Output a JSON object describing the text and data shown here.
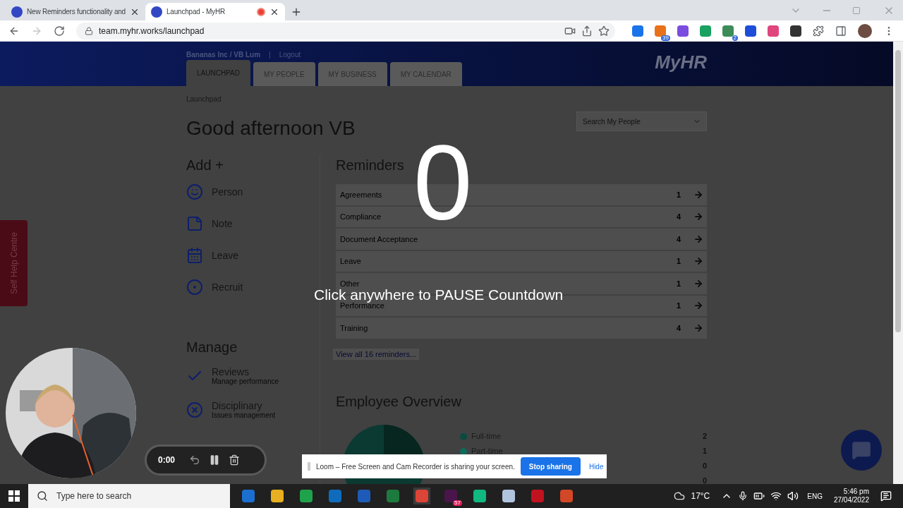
{
  "browser": {
    "tabs": [
      {
        "title": "New Reminders functionality and",
        "selected": false,
        "recording": false
      },
      {
        "title": "Launchpad - MyHR",
        "selected": true,
        "recording": true
      }
    ],
    "url": "team.myhr.works/launchpad",
    "extension_badges": [
      "39",
      "2"
    ]
  },
  "header": {
    "account": "Bananas Inc / VB Lum",
    "separator": "|",
    "logout": "Logout",
    "logo": "MyHR",
    "nav": [
      {
        "label": "LAUNCHPAD",
        "selected": true
      },
      {
        "label": "MY PEOPLE",
        "selected": false
      },
      {
        "label": "MY BUSINESS",
        "selected": false
      },
      {
        "label": "MY CALENDAR",
        "selected": false
      }
    ]
  },
  "breadcrumb": "Launchpad",
  "greeting": "Good afternoon VB",
  "search": {
    "placeholder": "Search My People"
  },
  "help_tab": "Self Help Centre",
  "add": {
    "title": "Add +",
    "items": [
      {
        "label": "Person",
        "kind": "person"
      },
      {
        "label": "Note",
        "kind": "note"
      },
      {
        "label": "Leave",
        "kind": "leave"
      },
      {
        "label": "Recruit",
        "kind": "recruit"
      }
    ]
  },
  "manage": {
    "title": "Manage",
    "items": [
      {
        "label": "Reviews",
        "subtitle": "Manage performance",
        "kind": "reviews"
      },
      {
        "label": "Disciplinary",
        "subtitle": "Issues management",
        "kind": "disciplinary"
      }
    ]
  },
  "reminders": {
    "title": "Reminders",
    "rows": [
      {
        "label": "Agreements",
        "count": "1"
      },
      {
        "label": "Compliance",
        "count": "4"
      },
      {
        "label": "Document Acceptance",
        "count": "4"
      },
      {
        "label": "Leave",
        "count": "1"
      },
      {
        "label": "Other",
        "count": "1"
      },
      {
        "label": "Performance",
        "count": "1"
      },
      {
        "label": "Training",
        "count": "4"
      }
    ],
    "view_all": "View all 16 reminders..."
  },
  "employee_overview": {
    "title": "Employee Overview",
    "legend": [
      {
        "label": "Full-time",
        "value": "2",
        "color": "#0b4a40"
      },
      {
        "label": "Part-time",
        "value": "1",
        "color": "#0f6a5b"
      },
      {
        "value": "0"
      },
      {
        "value": "0"
      }
    ]
  },
  "countdown": {
    "number": "0",
    "hint": "Click anywhere to PAUSE Countdown"
  },
  "recorder": {
    "time": "0:00"
  },
  "sharing_bar": {
    "message": "Loom – Free Screen and Cam Recorder is sharing your screen.",
    "stop": "Stop sharing",
    "hide": "Hide"
  },
  "taskbar": {
    "search_placeholder": "Type here to search",
    "slack_badge": "57",
    "weather": "17°C",
    "language": "ENG",
    "time": "5:46 pm",
    "date": "27/04/2022"
  }
}
